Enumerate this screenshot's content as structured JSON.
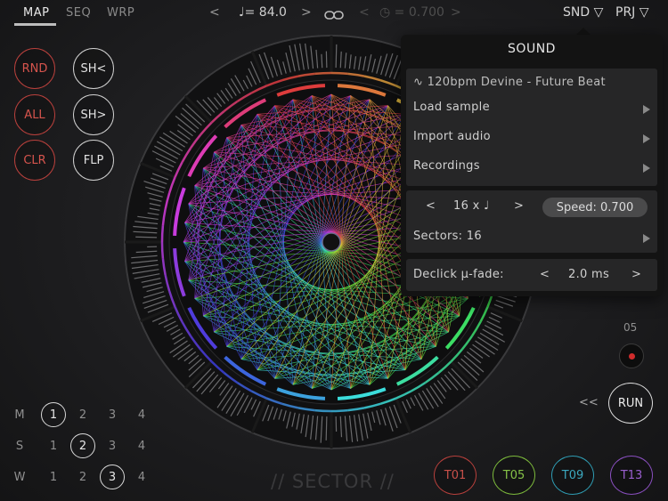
{
  "tabs": [
    {
      "label": "MAP"
    },
    {
      "label": "SEQ"
    },
    {
      "label": "WRP"
    }
  ],
  "topbar": {
    "tempo_prev": "<",
    "tempo_label": "♩= 84.0",
    "tempo_next": ">",
    "speed_prev": "<",
    "speed_label": "◷ = 0.700",
    "speed_next": ">",
    "snd_label": "SND ▽",
    "prj_label": "PRJ ▽"
  },
  "left_buttons": {
    "rnd": "RND",
    "all": "ALL",
    "clr": "CLR",
    "sh_left": "SH<",
    "sh_right": "SH>",
    "flp": "FLP"
  },
  "grid": {
    "rows": [
      {
        "label": "M",
        "values": [
          "1",
          "2",
          "3",
          "4"
        ],
        "selected": 0
      },
      {
        "label": "S",
        "values": [
          "1",
          "2",
          "3",
          "4"
        ],
        "selected": 1
      },
      {
        "label": "W",
        "values": [
          "1",
          "2",
          "3",
          "4"
        ],
        "selected": 2
      }
    ]
  },
  "right_controls": {
    "counter": "05",
    "rewind": "<<",
    "run": "RUN"
  },
  "tracks": [
    {
      "label": "T01",
      "color": "#b8403c"
    },
    {
      "label": "T05",
      "color": "#7dbb3c"
    },
    {
      "label": "T09",
      "color": "#2f9db4"
    },
    {
      "label": "T13",
      "color": "#8a4fc0"
    }
  ],
  "logo": "// SECTOR //",
  "sound_panel": {
    "title": "SOUND",
    "sample_name": "∿ 120bpm Devine - Future Beat",
    "load_sample": "Load sample",
    "import_audio": "Import audio",
    "recordings": "Recordings",
    "length_prev": "<",
    "length_value": "16 x ♩",
    "length_next": ">",
    "speed": "Speed: 0.700",
    "sectors": "Sectors: 16",
    "declick_label": "Declick µ-fade:",
    "declick_prev": "<",
    "declick_value": "2.0 ms",
    "declick_next": ">"
  },
  "colors": {
    "red": "#b8403c",
    "accent_text": "#e8e8e8"
  }
}
